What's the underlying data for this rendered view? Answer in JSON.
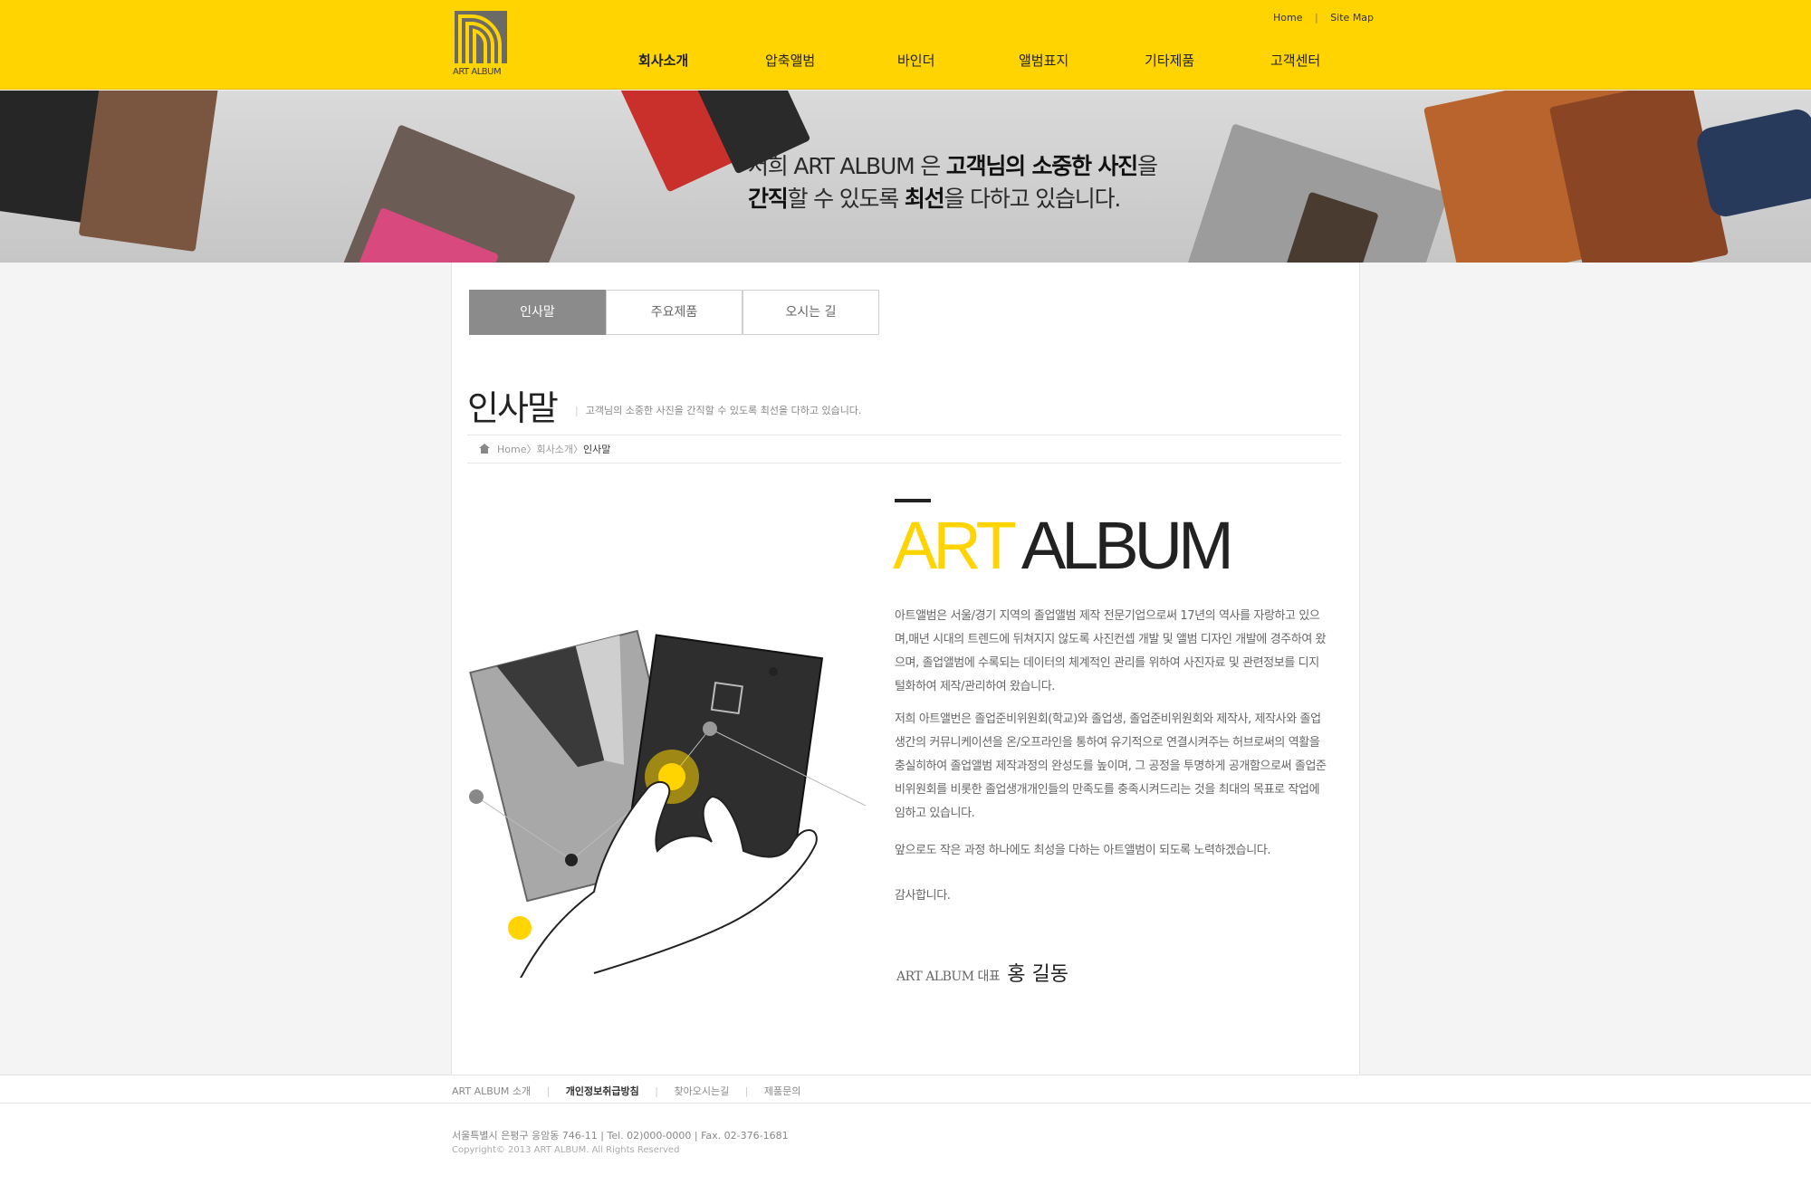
{
  "header": {
    "logo_text": "ART ALBUM",
    "util_links": [
      "Home",
      "Site Map"
    ],
    "util_sep": "|",
    "nav": [
      "회사소개",
      "압축앨범",
      "바인더",
      "앨범표지",
      "기타제품",
      "고객센터"
    ],
    "nav_active": "회사소개",
    "accent_color": "#ffd400"
  },
  "banner": {
    "line1_a": "저희 ART ALBUM 은 ",
    "line1_b": "고객님의 소중한 사진",
    "line1_c": "을",
    "line2_a": "간직",
    "line2_b": "할 수 있도록 ",
    "line2_c": "최선",
    "line2_d": "을 다하고 있습니다."
  },
  "tabs": [
    "인사말",
    "주요제품",
    "오시는 길"
  ],
  "page": {
    "title": "인사말",
    "subtitle": "고객님의 소중한 사진을 간직할 수 있도록 최선을 다하고 있습니다.",
    "breadcrumb": {
      "home": "Home",
      "section": "회사소개",
      "current": "인사말"
    }
  },
  "greeting": {
    "brand_yellow": "ART",
    "brand_dark": "ALBUM",
    "p1": "아트앨범은 서울/경기 지역의 졸업앨범 제작 전문기업으로써 17년의 역사를 자랑하고 있으며,매년 시대의 트렌드에 뒤쳐지지 않도록 사진컨셉 개발 및 앨범 디자인 개발에 경주하여 왔으며, 졸업앨범에 수록되는 데이터의 체계적인 관리를 위하여 사진자료 및 관련정보를 디지털화하여 제작/관리하여 왔습니다.",
    "p2": "저희 아트앨번은 졸업준비위원회(학교)와 졸업생, 졸업준비위원회와 제작사, 제작사와 졸업생간의 커뮤니케이션을 온/오프라인을 통하여 유기적으로 연결시켜주는 허브로써의 역활을 충실히하여 졸업앨범 제작과정의 완성도를 높이며, 그 공정을 투명하게 공개함으로써 졸업준비위원회를 비롯한 졸업생개개인들의 만족도를 충족시켜드리는 것을 최대의 목표로 작업에 임하고 있습니다.",
    "p3": "앞으로도 작은 과정 하나에도 최성을 다하는 아트앨범이 되도록 노력하겠습니다.",
    "p4": "감사합니다.",
    "sign_role": "ART ALBUM 대표",
    "sign_name": "홍 길동"
  },
  "footer": {
    "links": [
      "ART ALBUM 소개",
      "개인정보취급방침",
      "찾아오시는길",
      "제품문의"
    ],
    "sep": "|",
    "address": "서울특별시 은평구 응암동 746-11 | Tel. 02)000-0000 | Fax. 02-376-1681",
    "copyright": "Copyright© 2013 ART ALBUM. All Rights Reserved"
  }
}
